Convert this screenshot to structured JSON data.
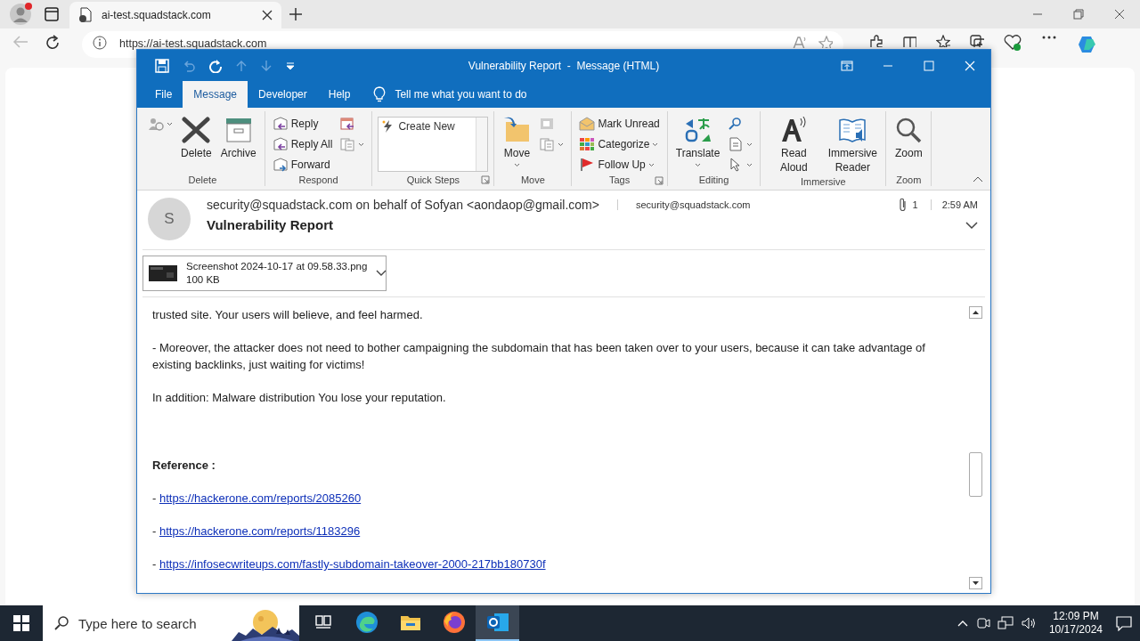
{
  "browser": {
    "tabs": [
      {
        "title": "ai-test.squadstack.com",
        "selected": true
      }
    ],
    "address": "https://ai-test.squadstack.com"
  },
  "outlook": {
    "title": "Vulnerability Report  -  Message (HTML)",
    "ribbon_tabs": [
      {
        "label": "File",
        "selected": false
      },
      {
        "label": "Message",
        "selected": true
      },
      {
        "label": "Developer",
        "selected": false
      },
      {
        "label": "Help",
        "selected": false
      }
    ],
    "tell_me": "Tell me what you want to do",
    "groups": [
      {
        "label": "Delete",
        "launcher": false,
        "items": [
          {
            "kind": "icon",
            "dropdown": true
          },
          {
            "kind": "large",
            "label": "Delete",
            "dropdown": false
          },
          {
            "kind": "large",
            "label": "Archive",
            "dropdown": false
          }
        ]
      },
      {
        "label": "Respond",
        "launcher": false,
        "items": [
          {
            "kind": "small",
            "label": "Reply",
            "dropdown": false
          },
          {
            "kind": "small",
            "label": "Reply All",
            "dropdown": false
          },
          {
            "kind": "small",
            "label": "Forward",
            "dropdown": false
          },
          {
            "kind": "icon",
            "dropdown": false
          },
          {
            "kind": "icon",
            "dropdown": true
          }
        ]
      },
      {
        "label": "Quick Steps",
        "launcher": true,
        "items": [
          {
            "kind": "gallery",
            "label": "Create New"
          }
        ]
      },
      {
        "label": "Move",
        "launcher": false,
        "items": [
          {
            "kind": "large",
            "label": "Move",
            "dropdown": true
          },
          {
            "kind": "icon",
            "dropdown": false
          },
          {
            "kind": "icon",
            "dropdown": true
          }
        ]
      },
      {
        "label": "Tags",
        "launcher": true,
        "items": [
          {
            "kind": "small",
            "label": "Mark Unread",
            "dropdown": false
          },
          {
            "kind": "small",
            "label": "Categorize",
            "dropdown": true
          },
          {
            "kind": "small",
            "label": "Follow Up",
            "dropdown": true
          }
        ]
      },
      {
        "label": "Editing",
        "launcher": false,
        "items": [
          {
            "kind": "large",
            "label": "Translate",
            "dropdown": true
          },
          {
            "kind": "icon",
            "dropdown": false
          },
          {
            "kind": "icon",
            "dropdown": true
          },
          {
            "kind": "icon",
            "dropdown": true
          }
        ]
      },
      {
        "label": "Immersive",
        "launcher": false,
        "items": [
          {
            "kind": "large",
            "label": "Read Aloud",
            "dropdown": false
          },
          {
            "kind": "large",
            "label": "Immersive Reader",
            "dropdown": false
          }
        ]
      },
      {
        "label": "Zoom",
        "launcher": false,
        "items": [
          {
            "kind": "large",
            "label": "Zoom",
            "dropdown": false
          }
        ]
      }
    ],
    "message": {
      "avatar_initial": "S",
      "from": "security@squadstack.com on behalf of Sofyan <aondaop@gmail.com>",
      "to": "security@squadstack.com",
      "attachment_count": "1",
      "time": "2:59 AM",
      "subject": "Vulnerability Report",
      "attachment": {
        "name": "Screenshot 2024-10-17 at 09.58.33.png",
        "size": "100 KB"
      },
      "body": [
        {
          "kind": "text",
          "text": "trusted site. Your users will believe, and feel harmed."
        },
        {
          "kind": "text",
          "text": "- Moreover, the attacker does not need to bother campaigning the subdomain that has been taken over to your users, because it can take advantage of existing backlinks, just waiting for victims!"
        },
        {
          "kind": "text",
          "text": "In addition: Malware distribution You lose your reputation."
        },
        {
          "kind": "heading",
          "text": "Reference :"
        },
        {
          "kind": "link",
          "prefix": "-",
          "text": "https://hackerone.com/reports/2085260"
        },
        {
          "kind": "link",
          "prefix": "-",
          "text": "https://hackerone.com/reports/1183296"
        },
        {
          "kind": "link",
          "prefix": "-",
          "text": "https://infosecwriteups.com/fastly-subdomain-takeover-2000-217bb180730f"
        }
      ]
    }
  },
  "taskbar": {
    "search_placeholder": "Type here to search",
    "apps": [
      {
        "selected": false
      },
      {
        "selected": false
      },
      {
        "selected": false
      },
      {
        "selected": false
      },
      {
        "selected": true
      }
    ],
    "time": "12:09 PM",
    "date": "10/17/2024"
  }
}
